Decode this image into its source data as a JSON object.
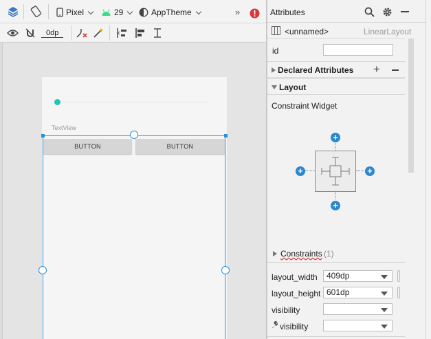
{
  "toolbar": {
    "device": "Pixel",
    "api_level": "29",
    "theme": "AppTheme",
    "margin_value": "0dp",
    "overflow_label": "»"
  },
  "canvas": {
    "textview_label": "TextView",
    "button_left": "BUTTON",
    "button_right": "BUTTON"
  },
  "attributes": {
    "title": "Attributes",
    "component_name": "<unnamed>",
    "component_type": "LinearLayout",
    "id_label": "id",
    "id_value": "",
    "declared_title": "Declared Attributes",
    "layout_title": "Layout",
    "constraint_widget_label": "Constraint Widget",
    "constraints_label": "Constraints",
    "constraints_count": "(1)",
    "layout_width_label": "layout_width",
    "layout_width_value": "409dp",
    "layout_height_label": "layout_height",
    "layout_height_value": "601dp",
    "visibility_label": "visibility",
    "visibility_value": "",
    "tools_visibility_label": "visibility",
    "tools_visibility_value": ""
  },
  "colors": {
    "accent": "#2d86d0",
    "teal": "#1fc7b4",
    "error": "#d9363e"
  }
}
